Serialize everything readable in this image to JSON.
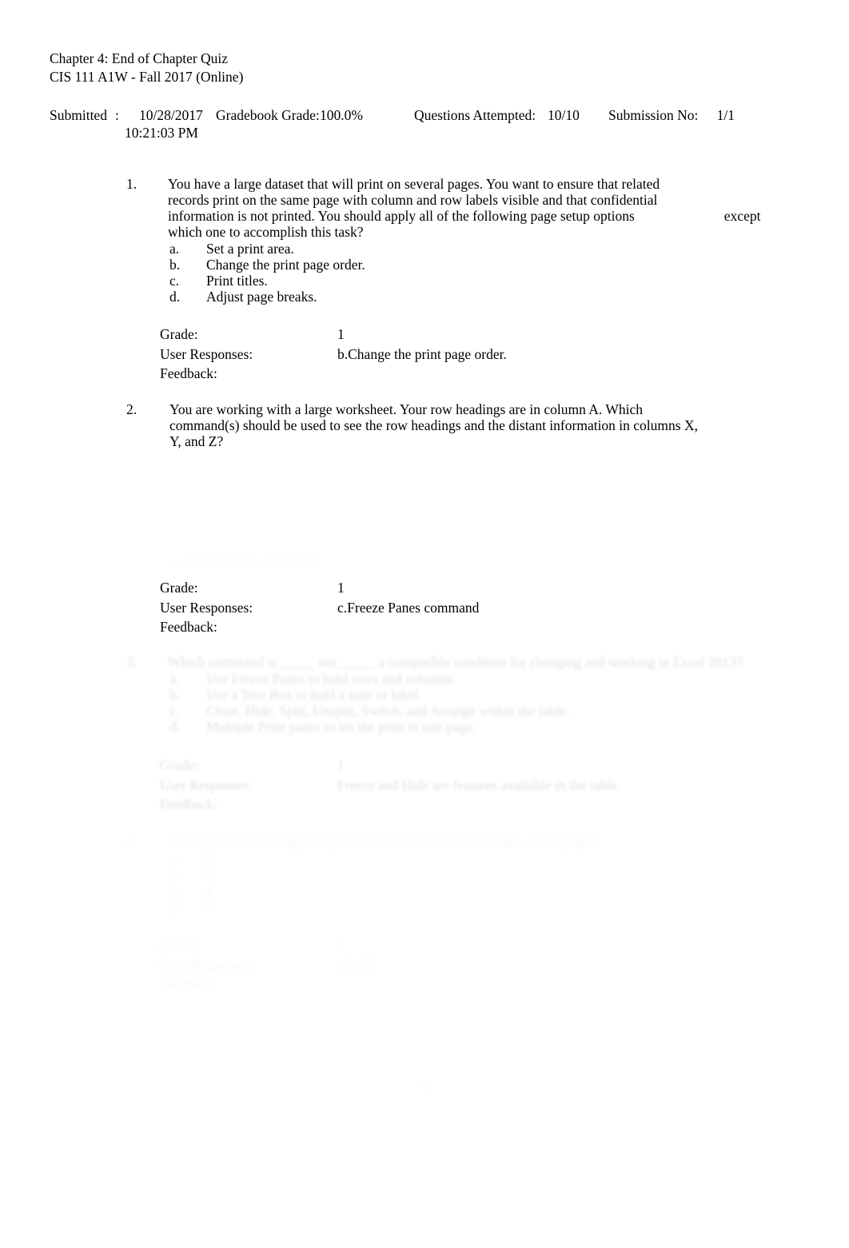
{
  "header": {
    "title": "Chapter 4: End of Chapter Quiz",
    "course": "CIS 111 A1W - Fall 2017 (Online)"
  },
  "meta": {
    "submitted_label": "Submitted",
    "submitted_colon": ":",
    "submitted_date": "10/28/2017",
    "submitted_time": "10:21:03 PM",
    "gradebook_label": "Gradebook Grade:",
    "gradebook_value": "100.0%",
    "questions_attempted_label": "Questions Attempted:",
    "questions_attempted_value": "10/10",
    "submission_no_label": "Submission No:",
    "submission_no_value": "1/1"
  },
  "labels": {
    "grade": "Grade:",
    "user_responses": "User Responses:",
    "feedback": "Feedback:"
  },
  "questions": [
    {
      "number": "1.",
      "text_line1": "You have a large dataset that will print on several pages. You want to ensure that related",
      "text_line2": "records print on the same page with column and row labels visible and that confidential",
      "text_line3": "information is not printed. You should apply all of the following page setup options",
      "text_line3_tail": "except",
      "text_line4": "which one to accomplish this task?",
      "options": [
        {
          "letter": "a.",
          "text": "Set a print area."
        },
        {
          "letter": "b.",
          "text": "Change the print page order."
        },
        {
          "letter": "c.",
          "text": "Print titles."
        },
        {
          "letter": "d.",
          "text": "Adjust page breaks."
        }
      ],
      "grade": "1",
      "user_response": "b.Change the print page order.",
      "feedback": ""
    },
    {
      "number": "2.",
      "text_line1": "You are working with a large worksheet. Your row headings are in column A. Which",
      "text_line2": "command(s) should be used to see the row headings and the distant information in columns X,",
      "text_line3": "Y, and Z?",
      "ghost_option": "c.     Freeze Panes command",
      "grade": "1",
      "user_response": "c.Freeze Panes command",
      "feedback": ""
    },
    {
      "number": "3.",
      "text_line1": "Which command is _____ not _____ a compatible condition for changing and working in Excel 2013?",
      "options": [
        {
          "letter": "a.",
          "text": "Use Freeze Panes to hold rows and columns."
        },
        {
          "letter": "b.",
          "text": "Use a Text Box to hold a note or label."
        },
        {
          "letter": "c.",
          "text": "Close, Hide, Split, Unsplit, Switch, and Arrange within the table."
        },
        {
          "letter": "d.",
          "text": "Multiple Print panes to set the print in one page."
        }
      ],
      "grade": "1",
      "user_response": "Freeze and Hide are features available in the table",
      "feedback": ""
    },
    {
      "number": "4.",
      "text_line1": "Which of the following elements are reflected in Excel Column of the pages?",
      "options": [
        {
          "letter": "a.",
          "text": "2"
        },
        {
          "letter": "b.",
          "text": "3"
        },
        {
          "letter": "c.",
          "text": "4"
        },
        {
          "letter": "d.",
          "text": "5"
        }
      ],
      "grade": "1",
      "user_response": "10.165",
      "feedback": ""
    }
  ],
  "footer": {
    "page_number": "1"
  }
}
